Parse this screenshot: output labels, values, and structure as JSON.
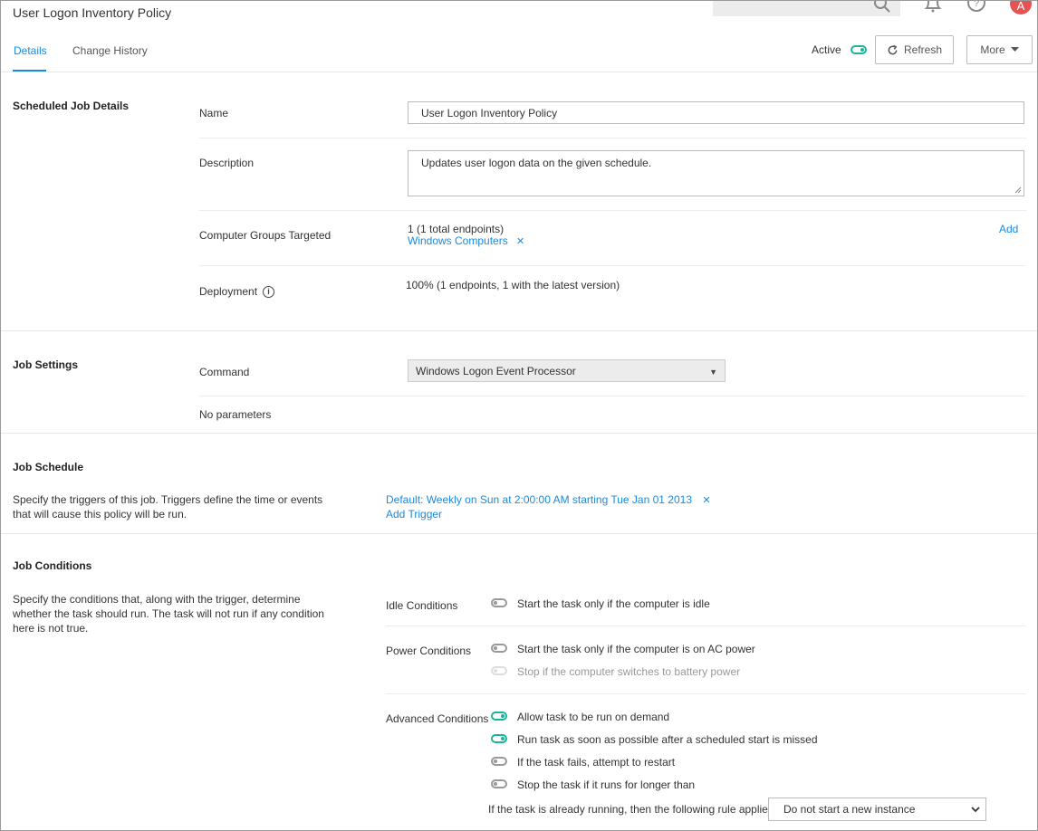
{
  "header": {
    "title": "User Logon Inventory Policy",
    "avatar_initial": "A",
    "tabs": [
      {
        "label": "Details",
        "active": true
      },
      {
        "label": "Change History",
        "active": false
      }
    ],
    "active_label": "Active",
    "active_on": true,
    "refresh_label": "Refresh",
    "more_label": "More"
  },
  "scheduled_job": {
    "section_title": "Scheduled Job Details",
    "name_label": "Name",
    "name_value": "User Logon Inventory Policy",
    "description_label": "Description",
    "description_value": "Updates user logon data on the given schedule.",
    "groups_label": "Computer Groups Targeted",
    "groups_count": "1 (1 total endpoints)",
    "groups_item": "Windows Computers",
    "add_label": "Add",
    "deployment_label": "Deployment",
    "deployment_value": "100% (1 endpoints, 1 with the latest version)"
  },
  "job_settings": {
    "section_title": "Job Settings",
    "command_label": "Command",
    "command_value": "Windows Logon Event Processor",
    "no_params": "No parameters"
  },
  "job_schedule": {
    "section_title": "Job Schedule",
    "description": "Specify the triggers of this job. Triggers define the time or events that will cause this policy will be run.",
    "trigger": "Default: Weekly on Sun at 2:00:00 AM starting Tue Jan 01 2013",
    "add_trigger": "Add Trigger"
  },
  "job_conditions": {
    "section_title": "Job Conditions",
    "description": "Specify the conditions that, along with the trigger, determine whether the task should run. The task will not run if any condition here is not true.",
    "idle_label": "Idle Conditions",
    "idle": [
      {
        "text": "Start the task only if the computer is idle",
        "state": "off"
      }
    ],
    "power_label": "Power Conditions",
    "power": [
      {
        "text": "Start the task only if the computer is on AC power",
        "state": "off"
      },
      {
        "text": "Stop if the computer switches to battery power",
        "state": "disabled"
      }
    ],
    "advanced_label": "Advanced Conditions",
    "advanced": [
      {
        "text": "Allow task to be run on demand",
        "state": "on"
      },
      {
        "text": "Run task as soon as possible after a scheduled start is missed",
        "state": "on"
      },
      {
        "text": "If the task fails, attempt to restart",
        "state": "off"
      },
      {
        "text": "Stop the task if it runs for longer than",
        "state": "off"
      }
    ],
    "running_rule_label": "If the task is already running, then the following rule applies",
    "running_rule_value": "Do not start a new instance"
  },
  "colors": {
    "accent": "#1a8ae0",
    "toggle_on": "#1bb59a",
    "avatar": "#e55353"
  }
}
